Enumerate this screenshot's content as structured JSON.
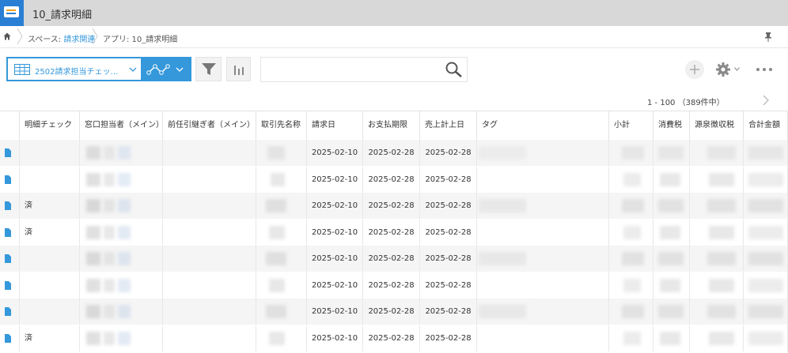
{
  "header": {
    "title": "10_請求明細",
    "icon": "app-icon",
    "color": "#2a7fd4"
  },
  "breadcrumb": {
    "space_prefix": "スペース: ",
    "space_name": "請求関連",
    "app_label": "アプリ: 10_請求明細"
  },
  "toolbar": {
    "view_name": "2502請求担当チェッ…",
    "accent_color": "#3498db",
    "search": {
      "value": "",
      "placeholder": ""
    }
  },
  "pagination": {
    "text": "1 - 100 （389件中）"
  },
  "table": {
    "columns": [
      "明細チェック",
      "窓口担当者（メイン）",
      "前任引継ぎ者（メイン）",
      "取引先名称",
      "請求日",
      "お支払期限",
      "売上計上日",
      "タグ",
      "小計",
      "消費税",
      "源泉徴収税",
      "合計金額"
    ],
    "rows": [
      {
        "check": "",
        "invoice_date": "2025-02-10",
        "due_date": "2025-02-28",
        "sales_date": "2025-02-28"
      },
      {
        "check": "",
        "invoice_date": "2025-02-10",
        "due_date": "2025-02-28",
        "sales_date": "2025-02-28"
      },
      {
        "check": "済",
        "invoice_date": "2025-02-10",
        "due_date": "2025-02-28",
        "sales_date": "2025-02-28"
      },
      {
        "check": "済",
        "invoice_date": "2025-02-10",
        "due_date": "2025-02-28",
        "sales_date": "2025-02-28"
      },
      {
        "check": "",
        "invoice_date": "2025-02-10",
        "due_date": "2025-02-28",
        "sales_date": "2025-02-28"
      },
      {
        "check": "",
        "invoice_date": "2025-02-10",
        "due_date": "2025-02-28",
        "sales_date": "2025-02-28"
      },
      {
        "check": "",
        "invoice_date": "2025-02-10",
        "due_date": "2025-02-28",
        "sales_date": "2025-02-28"
      },
      {
        "check": "済",
        "invoice_date": "2025-02-10",
        "due_date": "2025-02-28",
        "sales_date": "2025-02-28"
      }
    ]
  }
}
